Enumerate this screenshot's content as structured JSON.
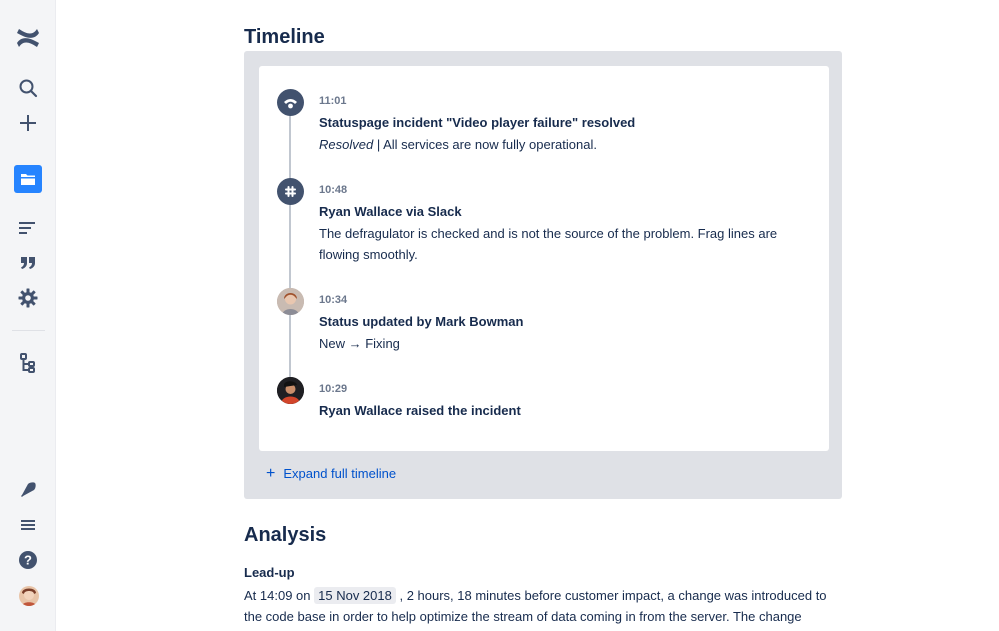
{
  "sidebar": {
    "icons": [
      "confluence-logo",
      "search-icon",
      "plus-icon",
      "folder-icon",
      "menu-lines-icon",
      "quote-icon",
      "gear-icon",
      "tree-icon",
      "notification-icon",
      "hamburger-icon",
      "help-icon",
      "user-avatar"
    ]
  },
  "timeline": {
    "heading": "Timeline",
    "items": [
      {
        "time": "11:01",
        "title": "Statuspage incident \"Video player failure\" resolved",
        "desc_italic": "Resolved",
        "desc_rest": " | All services are now fully operational."
      },
      {
        "time": "10:48",
        "title": "Ryan Wallace via Slack",
        "desc": "The defragulator is checked and is not the source of the problem. Frag lines are flowing smoothly."
      },
      {
        "time": "10:34",
        "title": "Status updated by Mark Bowman",
        "desc": "New → Fixing"
      },
      {
        "time": "10:29",
        "title": "Ryan Wallace raised the incident"
      }
    ],
    "expand_label": "Expand full timeline"
  },
  "analysis": {
    "heading": "Analysis",
    "subheading": "Lead-up",
    "para_start": "At 14:09 on ",
    "date": "15 Nov 2018",
    "para_rest": " , 2 hours, 18 minutes before customer impact, a change was introduced to the code base in order to help optimize the stream of data coming in from the server. The change"
  },
  "colors": {
    "accent": "#0052CC",
    "sidebar_active": "#2684FF",
    "icon_dark": "#42526E",
    "panel": "#DFE1E6"
  }
}
